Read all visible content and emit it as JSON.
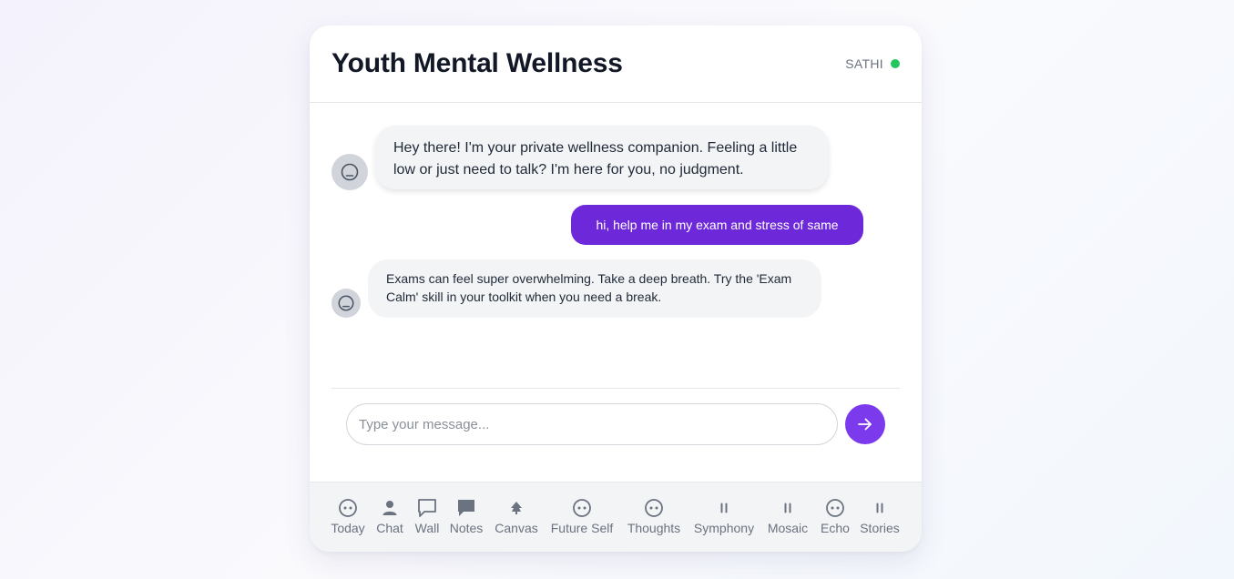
{
  "header": {
    "title": "Youth Mental Wellness",
    "companion_name": "SATHI",
    "status_color": "#22c55e"
  },
  "messages": [
    {
      "sender": "bot",
      "icon": "bot-face-icon",
      "text": "Hey there! I'm your private wellness companion. Feeling a little low or just need to talk? I'm here for you, no judgment."
    },
    {
      "sender": "user",
      "text": "hi, help me in my exam and stress of same"
    },
    {
      "sender": "bot",
      "icon": "bot-face-icon",
      "text": "Exams can feel super overwhelming. Take a deep breath. Try the 'Exam Calm' skill in your toolkit when you need a break."
    }
  ],
  "composer": {
    "placeholder": "Type your message...",
    "value": "",
    "send_icon": "arrow-right-icon"
  },
  "nav": {
    "items": [
      {
        "label": "Today",
        "icon": "face-icon"
      },
      {
        "label": "Chat",
        "icon": "person-icon"
      },
      {
        "label": "Wall",
        "icon": "speech-bubble-outline-icon"
      },
      {
        "label": "Notes",
        "icon": "speech-bubble-filled-icon"
      },
      {
        "label": "Canvas",
        "icon": "tree-icon"
      },
      {
        "label": "Future Self",
        "icon": "face-icon"
      },
      {
        "label": "Thoughts",
        "icon": "face-icon"
      },
      {
        "label": "Symphony",
        "icon": "pause-icon"
      },
      {
        "label": "Mosaic",
        "icon": "pause-icon"
      },
      {
        "label": "Echo",
        "icon": "face-icon"
      },
      {
        "label": "Stories",
        "icon": "pause-icon"
      }
    ]
  },
  "colors": {
    "accent": "#7c3aed",
    "user_bubble": "#6d28d9",
    "bot_bubble": "#f3f4f6",
    "status_online": "#22c55e"
  }
}
